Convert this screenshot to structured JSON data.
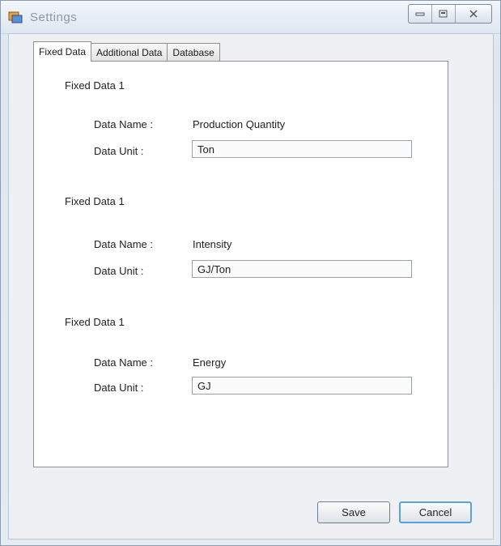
{
  "window": {
    "title": "Settings"
  },
  "title_controls": [
    "minimize-icon",
    "maximize-icon",
    "close-icon"
  ],
  "tabs": [
    {
      "label": "Fixed Data",
      "active": true
    },
    {
      "label": "Additional Data",
      "active": false
    },
    {
      "label": "Database",
      "active": false
    }
  ],
  "groups": [
    {
      "title": "Fixed Data 1",
      "name_label": "Data Name :",
      "name_value": "Production Quantity",
      "unit_label": "Data Unit :",
      "unit_value": "Ton"
    },
    {
      "title": "Fixed Data 1",
      "name_label": "Data Name :",
      "name_value": "Intensity",
      "unit_label": "Data Unit :",
      "unit_value": "GJ/Ton"
    },
    {
      "title": "Fixed Data 1",
      "name_label": "Data Name :",
      "name_value": "Energy",
      "unit_label": "Data Unit :",
      "unit_value": "GJ"
    }
  ],
  "buttons": {
    "save": "Save",
    "cancel": "Cancel"
  },
  "colors": {
    "accent_focus": "#5aa3d9",
    "title_text": "#8c97a6"
  }
}
